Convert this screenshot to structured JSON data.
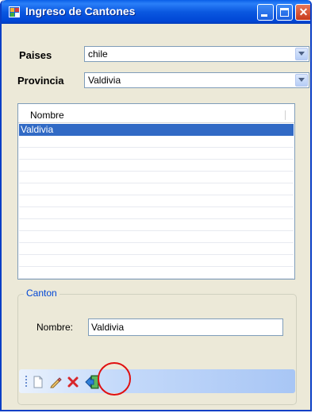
{
  "window": {
    "title": "Ingreso de Cantones",
    "controls": [
      "minimize-icon",
      "maximize-icon",
      "close-icon"
    ]
  },
  "form": {
    "paises_label": "Paises",
    "paises_value": "chile",
    "provincia_label": "Provincia",
    "provincia_value": "Valdivia"
  },
  "list": {
    "column": "Nombre",
    "rows": [
      "Valdivia"
    ],
    "selected_index": 0
  },
  "group": {
    "title": "Canton",
    "nombre_label": "Nombre:",
    "nombre_value": "Valdivia"
  },
  "toolbar": {
    "icons": [
      "new-document-icon",
      "edit-pencil-icon",
      "delete-x-icon",
      "exit-door-icon"
    ]
  },
  "colors": {
    "titlebar": "#0a58e0",
    "selection": "#316ac5",
    "window_bg": "#ece9d8",
    "highlight_circle": "#e01010",
    "group_title": "#0046d5"
  }
}
